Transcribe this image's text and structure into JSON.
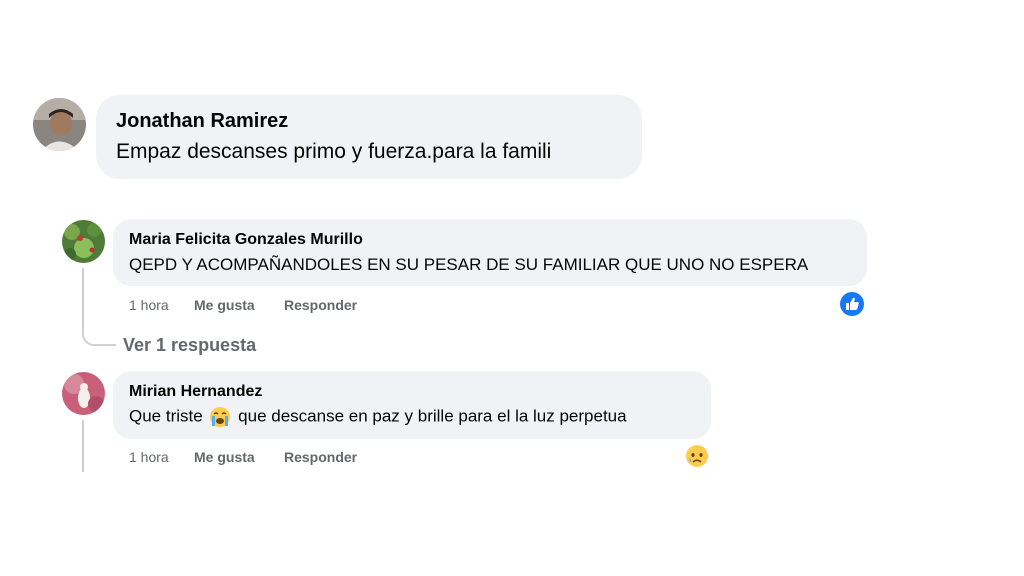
{
  "comments": [
    {
      "author": "Jonathan Ramirez",
      "text": "Empaz descanses primo y fuerza.para la famili"
    },
    {
      "author": "Maria Felicita Gonzales Murillo",
      "text": "QEPD Y ACOMPAÑANDOLES EN SU PESAR DE SU FAMILIAR QUE UNO NO ESPERA",
      "time": "1 hora",
      "like_label": "Me gusta",
      "reply_label": "Responder",
      "reaction_icon": "like-reaction-icon",
      "view_replies": "Ver 1 respuesta"
    },
    {
      "author": "Mirian Hernandez",
      "text_before": "Que triste",
      "text_after": "que descanse en paz y brille para el la luz perpetua",
      "inline_icon": "crying-face-emoji",
      "time": "1 hora",
      "like_label": "Me gusta",
      "reply_label": "Responder",
      "reaction_icon": "sad-reaction-icon"
    }
  ],
  "colors": {
    "bubble": "#f0f2f5",
    "meta_text": "#65676b",
    "like_blue": "#1877f2",
    "thread_line": "#ced0d4"
  }
}
